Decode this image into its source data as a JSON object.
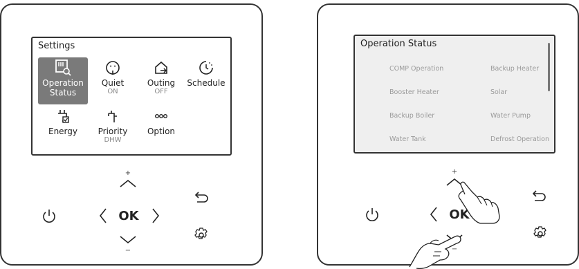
{
  "left": {
    "screen": {
      "title": "Settings",
      "tiles": [
        {
          "label": "Operation Status",
          "sub": "",
          "icon": "operation-status-icon",
          "selected": true
        },
        {
          "label": "Quiet",
          "sub": "ON",
          "icon": "quiet-icon"
        },
        {
          "label": "Outing",
          "sub": "OFF",
          "icon": "outing-icon"
        },
        {
          "label": "Schedule",
          "sub": "",
          "icon": "schedule-icon"
        },
        {
          "label": "Energy",
          "sub": "",
          "icon": "energy-icon"
        },
        {
          "label": "Priority",
          "sub": "DHW",
          "icon": "priority-icon"
        },
        {
          "label": "Option",
          "sub": "",
          "icon": "option-icon"
        }
      ]
    },
    "controls": {
      "ok": "OK",
      "plus": "+",
      "minus": "−"
    }
  },
  "right": {
    "screen": {
      "title": "Operation Status",
      "items": [
        "COMP Operation",
        "Backup Heater",
        "Booster Heater",
        "Solar",
        "Backup Boiler",
        "Water Pump",
        "Water Tank",
        "Defrost Operation"
      ]
    },
    "controls": {
      "ok": "OK",
      "plus": "+",
      "minus": "−"
    }
  },
  "colors": {
    "selected_tile": "#7a7a7a",
    "status_screen_bg": "#efefef"
  }
}
